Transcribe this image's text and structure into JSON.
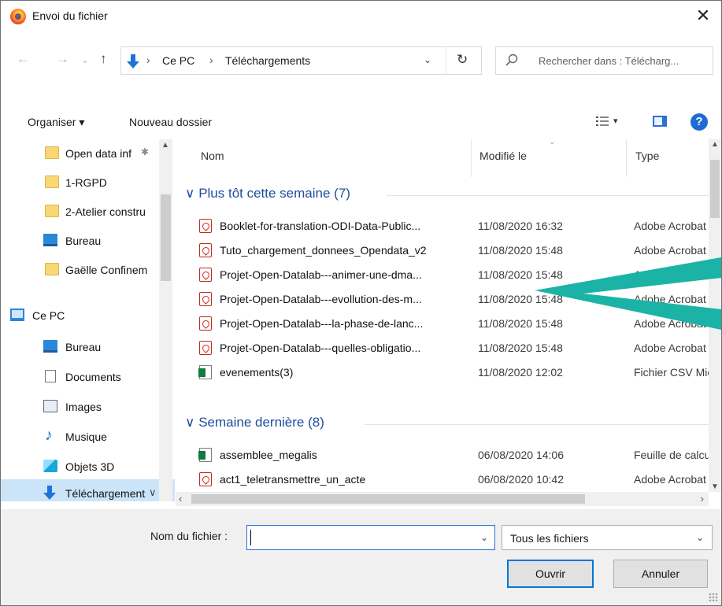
{
  "window": {
    "title": "Envoi du fichier",
    "close_glyph": "✕"
  },
  "nav": {
    "back_glyph": "←",
    "forward_glyph": "→",
    "recent_glyph": "⌄",
    "up_glyph": "↑",
    "breadcrumb": [
      "Ce PC",
      "Téléchargements"
    ],
    "breadcrumb_sep": "›",
    "dropdown_glyph": "⌄",
    "refresh_glyph": "↻",
    "search_placeholder": "Rechercher dans : Télécharg..."
  },
  "toolbar": {
    "organize_label": "Organiser ▾",
    "new_folder_label": "Nouveau dossier",
    "view_dropdown_glyph": "▾",
    "help_glyph": "?"
  },
  "sidebar": {
    "items": [
      {
        "label": "Open data inf",
        "icon": "folder-icon",
        "pinned": true
      },
      {
        "label": "1-RGPD",
        "icon": "folder-icon"
      },
      {
        "label": "2-Atelier constru",
        "icon": "folder-icon"
      },
      {
        "label": "Bureau",
        "icon": "desktop-icon"
      },
      {
        "label": "Gaëlle Confinem",
        "icon": "folder-icon"
      },
      {
        "label": "Ce PC",
        "icon": "computer-icon"
      },
      {
        "label": "Bureau",
        "icon": "desktop-icon"
      },
      {
        "label": "Documents",
        "icon": "documents-icon"
      },
      {
        "label": "Images",
        "icon": "images-icon"
      },
      {
        "label": "Musique",
        "icon": "music-icon"
      },
      {
        "label": "Objets 3D",
        "icon": "objects-3d-icon"
      },
      {
        "label": "Téléchargements",
        "icon": "downloads-icon",
        "selected": true
      }
    ],
    "pin_glyph": "📌",
    "scroll_up": "▲",
    "scroll_down": "▼",
    "collapse_glyph": "∨"
  },
  "columns": {
    "name": "Nom",
    "modified": "Modifié le",
    "type": "Type",
    "sort_glyph": "⌄"
  },
  "groups": [
    {
      "header": "Plus tôt cette semaine (7)",
      "files": [
        {
          "name": "Booklet-for-translation-ODI-Data-Public...",
          "date": "11/08/2020 16:32",
          "type": "Adobe Acrobat",
          "icon": "pdf-icon"
        },
        {
          "name": "Tuto_chargement_donnees_Opendata_v2",
          "date": "11/08/2020 15:48",
          "type": "Adobe Acrobat",
          "icon": "pdf-icon"
        },
        {
          "name": "Projet-Open-Datalab---animer-une-dma...",
          "date": "11/08/2020 15:48",
          "type": "Adobe Acrobat",
          "icon": "pdf-icon"
        },
        {
          "name": "Projet-Open-Datalab---evollution-des-m...",
          "date": "11/08/2020 15:48",
          "type": "Adobe Acrobat",
          "icon": "pdf-icon"
        },
        {
          "name": "Projet-Open-Datalab---la-phase-de-lanc...",
          "date": "11/08/2020 15:48",
          "type": "Adobe Acrobat",
          "icon": "pdf-icon"
        },
        {
          "name": "Projet-Open-Datalab---quelles-obligatio...",
          "date": "11/08/2020 15:48",
          "type": "Adobe Acrobat",
          "icon": "pdf-icon"
        },
        {
          "name": "evenements(3)",
          "date": "11/08/2020 12:02",
          "type": "Fichier CSV Microsoft",
          "icon": "excel-csv-icon"
        }
      ]
    },
    {
      "header": "Semaine dernière (8)",
      "files": [
        {
          "name": "assemblee_megalis",
          "date": "06/08/2020 14:06",
          "type": "Feuille de calcul",
          "icon": "excel-icon"
        },
        {
          "name": "act1_teletransmettre_un_acte",
          "date": "06/08/2020 10:42",
          "type": "Adobe Acrobat",
          "icon": "pdf-icon"
        }
      ]
    }
  ],
  "group_collapse_glyph": "∨",
  "scroll": {
    "up": "▲",
    "down": "▼",
    "left": "‹",
    "right": "›"
  },
  "footer": {
    "filename_label": "Nom du fichier :",
    "filename_value": "",
    "filename_dropdown_glyph": "⌄",
    "filetype_value": "Tous les fichiers",
    "filetype_dropdown_glyph": "⌄",
    "open_label": "Ouvrir",
    "cancel_label": "Annuler"
  },
  "colors": {
    "accent": "#0078d7",
    "group_header": "#1e4e9c",
    "selection": "#cce4f7",
    "annotation_arrow": "#1ab3a6"
  }
}
